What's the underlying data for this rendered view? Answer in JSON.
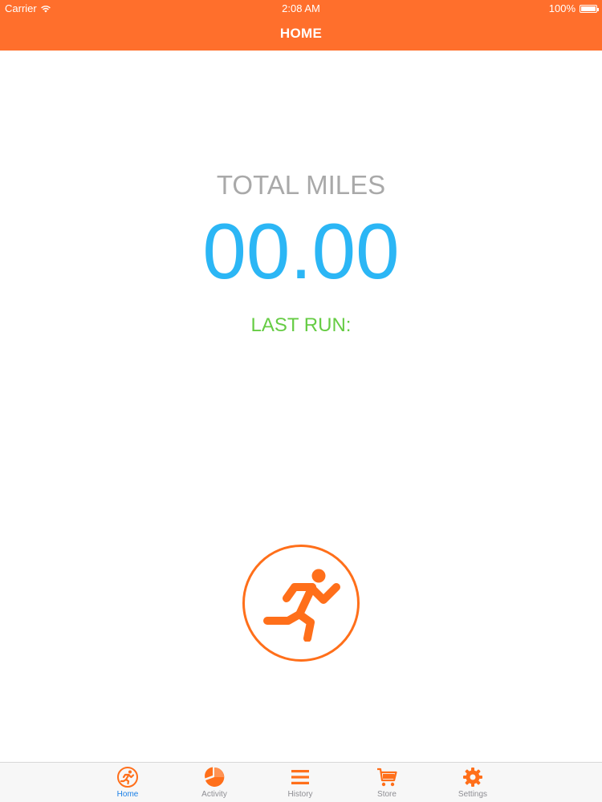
{
  "status_bar": {
    "carrier": "Carrier",
    "time": "2:08 AM",
    "battery": "100%"
  },
  "nav": {
    "title": "HOME"
  },
  "stats": {
    "total_label": "TOTAL MILES",
    "total_value": "00.00",
    "last_run_label": "LAST RUN:"
  },
  "tabs": [
    {
      "label": "Home",
      "icon": "runner-circle-icon",
      "active": true
    },
    {
      "label": "Activity",
      "icon": "pie-chart-icon",
      "active": false
    },
    {
      "label": "History",
      "icon": "list-icon",
      "active": false
    },
    {
      "label": "Store",
      "icon": "cart-icon",
      "active": false
    },
    {
      "label": "Settings",
      "icon": "gear-icon",
      "active": false
    }
  ],
  "colors": {
    "accent": "#ff6f2c",
    "total_value": "#2bb6f5",
    "last_run": "#66cc44",
    "tab_active": "#1a7fe6"
  }
}
